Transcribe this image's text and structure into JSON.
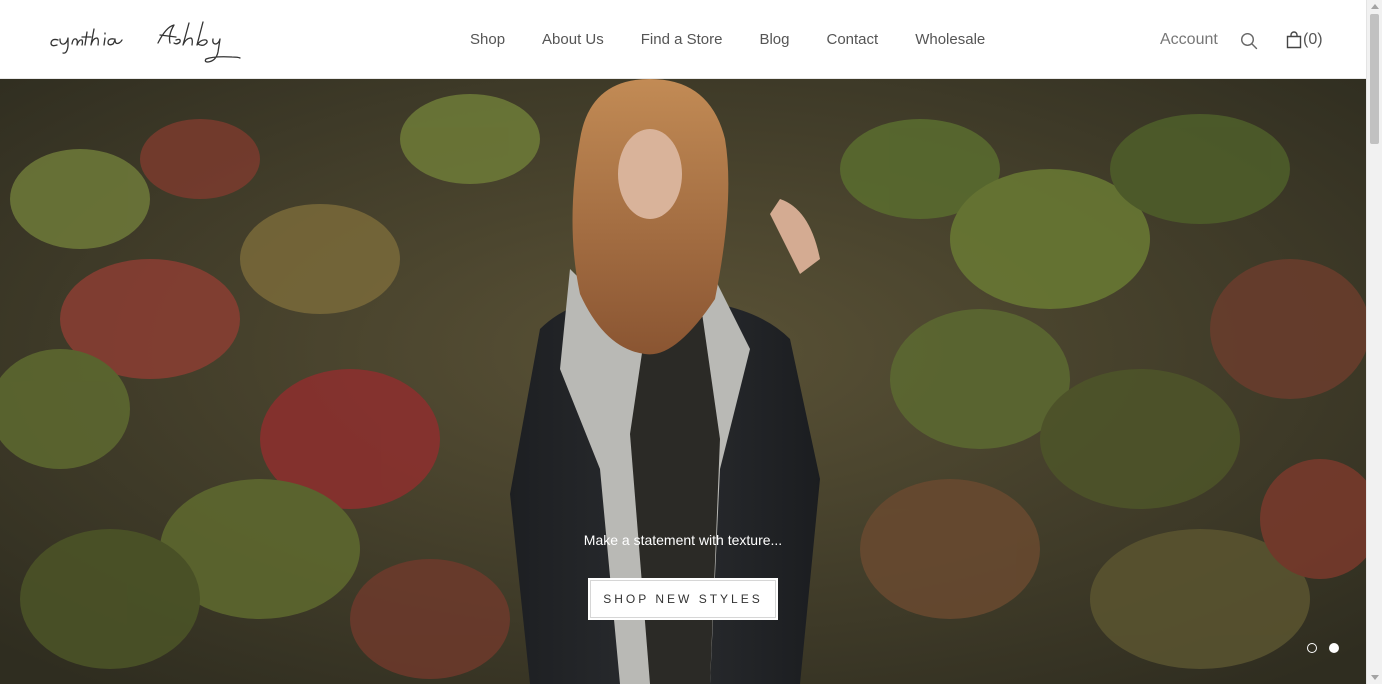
{
  "brand": {
    "name": "cynthia Ashby",
    "logo_icon": "signature-logo"
  },
  "nav": {
    "items": [
      {
        "label": "Shop"
      },
      {
        "label": "About Us"
      },
      {
        "label": "Find a Store"
      },
      {
        "label": "Blog"
      },
      {
        "label": "Contact"
      },
      {
        "label": "Wholesale"
      }
    ]
  },
  "header_actions": {
    "account_label": "Account",
    "search_icon": "search-icon",
    "cart_icon": "shopping-bag-icon",
    "cart_count": "(0)"
  },
  "hero": {
    "caption": "Make a statement with texture...",
    "button_label": "SHOP NEW STYLES",
    "slide_count": 2,
    "active_slide": 2
  },
  "colors": {
    "header_bg": "#ffffff",
    "nav_text": "#555555",
    "hero_overlay": "#3d3b2c",
    "button_bg": "#ffffff"
  }
}
